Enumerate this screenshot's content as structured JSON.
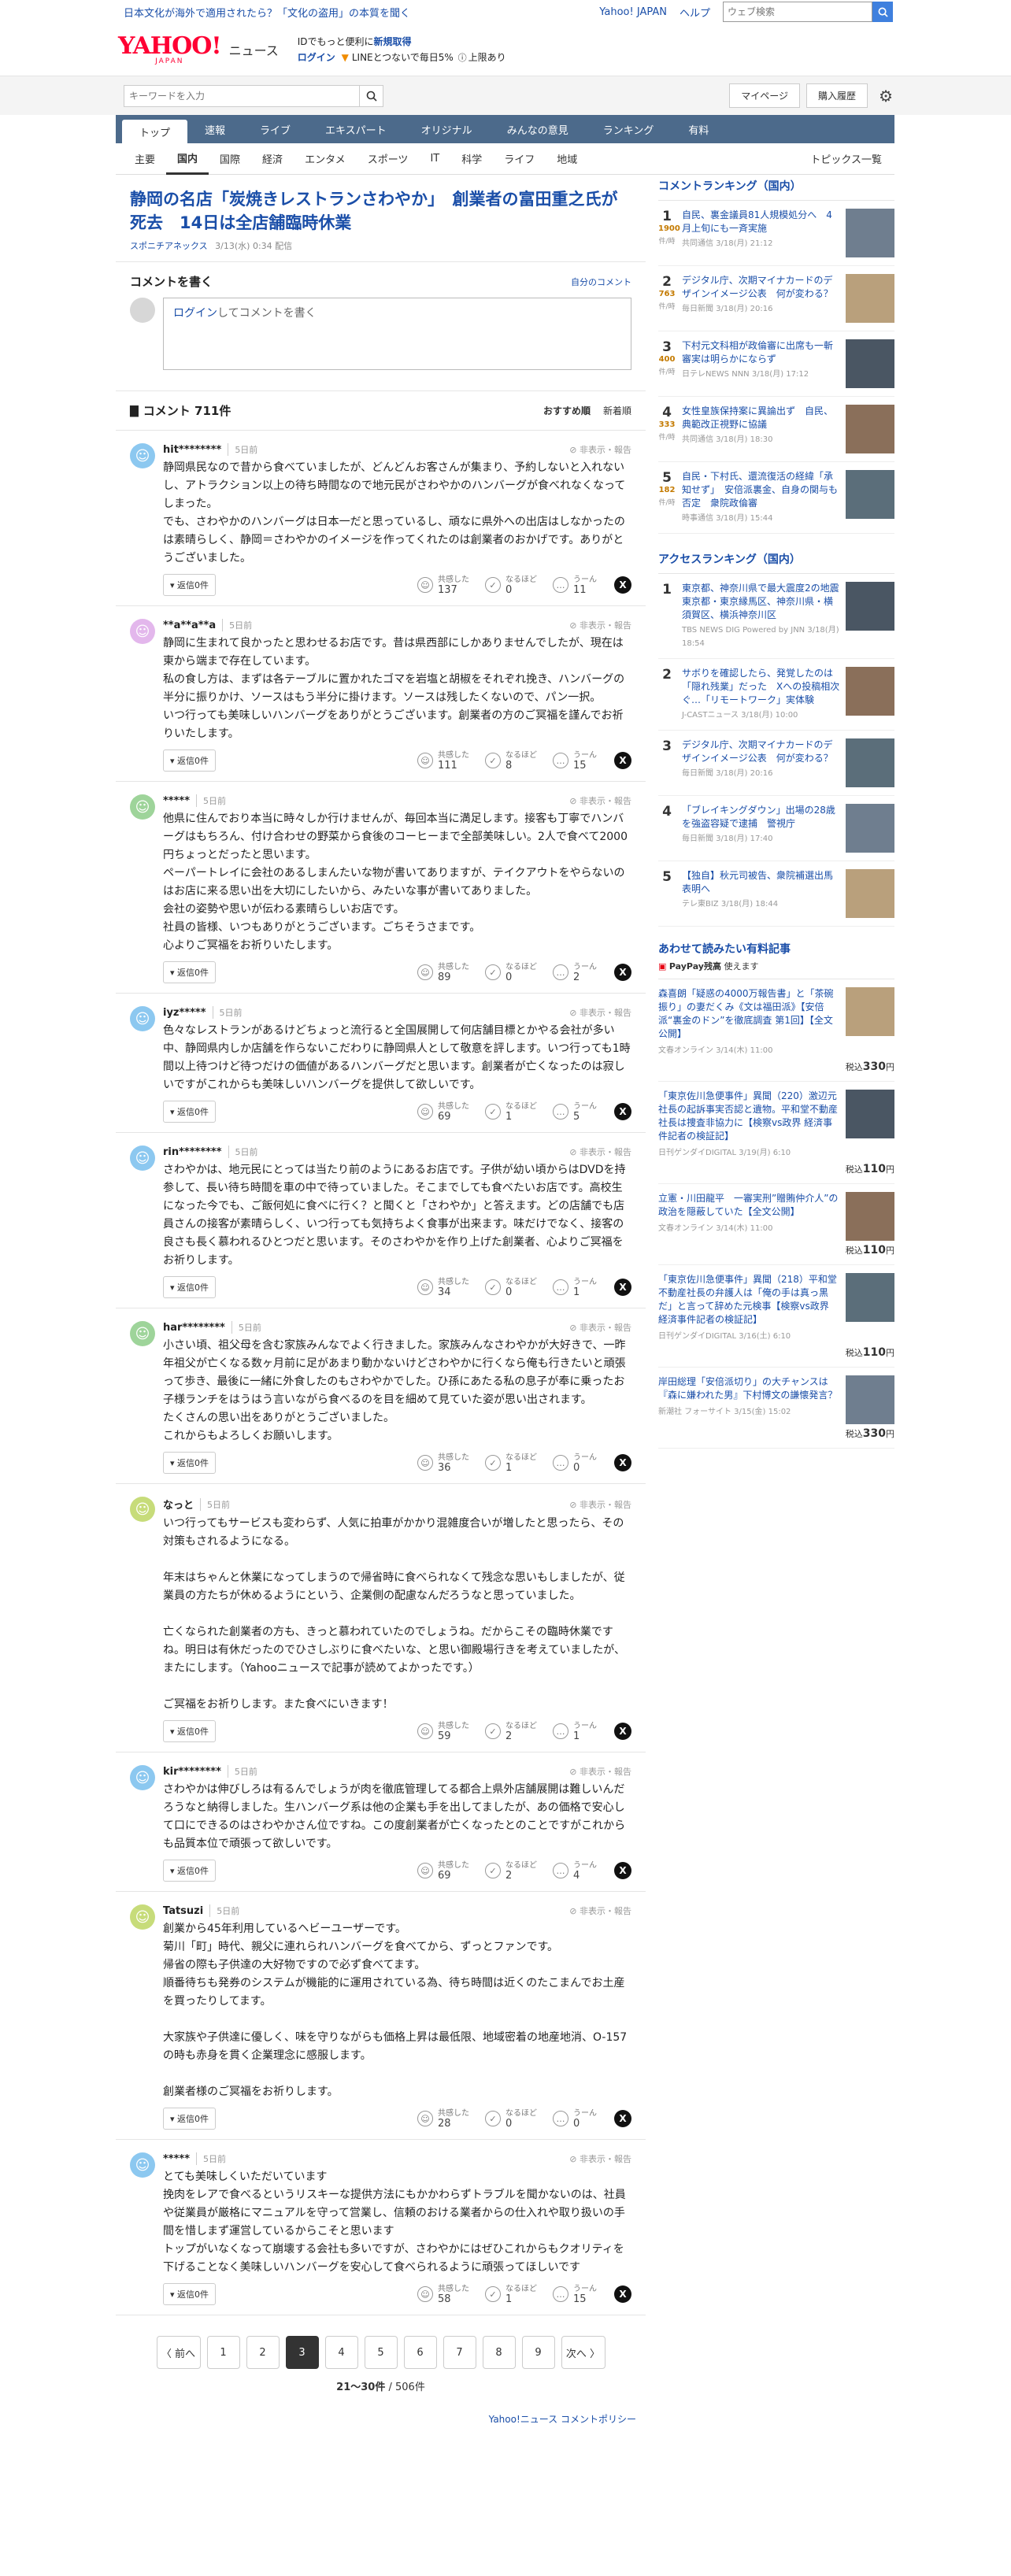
{
  "top": {
    "promo": "日本文化が海外で適用されたら？「文化の盗用」の本質を聞く",
    "yahoo_japan": "Yahoo! JAPAN",
    "help": "ヘルプ",
    "search_placeholder": "ウェブ検索"
  },
  "logo": {
    "brand": "YAHOO!",
    "jp": "JAPAN",
    "news": "ニュース"
  },
  "promo_box": {
    "l1a": "IDでもっと便利に",
    "l1b": "新規取得",
    "l2a": "ログイン",
    "l2b": "LINEとつないで毎日5%",
    "l2c": "上限あり"
  },
  "searchrow": {
    "placeholder": "キーワードを入力",
    "mypage": "マイページ",
    "history": "購入履歴"
  },
  "nav": [
    "トップ",
    "速報",
    "ライブ",
    "エキスパート",
    "オリジナル",
    "みんなの意見",
    "ランキング",
    "有料"
  ],
  "subnav": [
    "主要",
    "国内",
    "国際",
    "経済",
    "エンタメ",
    "スポーツ",
    "IT",
    "科学",
    "ライフ",
    "地域"
  ],
  "subnav_topics": "トピックス一覧",
  "article": {
    "title": "静岡の名店「炭焼きレストランさわやか」　創業者の富田重之氏が死去　14日は全店舗臨時休業",
    "source": "スポニチアネックス",
    "date": "3/13(水) 0:34 配信"
  },
  "comment_write": {
    "title": "コメントを書く",
    "own": "自分のコメント",
    "login": "ログイン",
    "rest": "してコメントを書く"
  },
  "comment_list": {
    "title": "コメント 711件",
    "sort1": "おすすめ順",
    "sort2": "新着順"
  },
  "labels": {
    "report": "非表示・報告",
    "reply": "返信0件",
    "r1": "共感した",
    "r2": "なるほど",
    "r3": "うーん"
  },
  "comments": [
    {
      "user": "hit********",
      "time": "5日前",
      "text": "静岡県民なので昔から食べていましたが、どんどんお客さんが集まり、予約しないと入れないし、アトラクション以上の待ち時間なので地元民がさわやかのハンバーグが食べれなくなってしまった。\nでも、さわやかのハンバーグは日本一だと思っているし、頑なに県外への出店はしなかったのは素晴らしく、静岡＝さわやかのイメージを作ってくれたのは創業者のおかげです。ありがとうございました。",
      "r1": "137",
      "r2": "0",
      "r3": "11",
      "color": "#8cc8f0",
      "face": "☺"
    },
    {
      "user": "**a**a**a",
      "time": "5日前",
      "text": "静岡に生まれて良かったと思わせるお店です。昔は県西部にしかありませんでしたが、現在は東から端まで存在しています。\n私の食し方は、まずは各テーブルに置かれたゴマを岩塩と胡椒をそれぞれ挽き、ハンバーグの半分に振りかけ、ソースはもう半分に掛けます。ソースは残したくないので、パン一択。\nいつ行っても美味しいハンバーグをありがとうございます。創業者の方のご冥福を謹んでお祈りいたします。",
      "r1": "111",
      "r2": "8",
      "r3": "15",
      "color": "#e3b7ec",
      "face": "☺"
    },
    {
      "user": "*****",
      "time": "5日前",
      "text": "他県に住んでおり本当に時々しか行けませんが、毎回本当に満足します。接客も丁寧でハンバーグはもちろん、付け合わせの野菜から食後のコーヒーまで全部美味しい。2人で食べて2000円ちょっとだったと思います。\nペーパートレイに会社のあるしまんたいな物が書いてありますが、テイクアウトをやらないのはお店に来る思い出を大切にしたいから、みたいな事が書いてありました。\n会社の姿勢や思いが伝わる素晴らしいお店です。\n社員の皆様、いつもありがとうございます。ごちそうさまです。\n心よりご冥福をお祈りいたします。",
      "r1": "89",
      "r2": "0",
      "r3": "2",
      "color": "#9ed49a",
      "face": "☺"
    },
    {
      "user": "iyz*****",
      "time": "5日前",
      "text": "色々なレストランがあるけどちょっと流行ると全国展開して何店舗目標とかやる会社が多い中、静岡県内しか店舗を作らないこだわりに静岡県人として敬意を評します。いつ行っても1時間以上待つけど待つだけの価値があるハンバーグだと思います。創業者が亡くなったのは寂しいですがこれからも美味しいハンバーグを提供して欲しいです。",
      "r1": "69",
      "r2": "1",
      "r3": "5",
      "color": "#8cc8f0",
      "face": "☺"
    },
    {
      "user": "rin********",
      "time": "5日前",
      "text": "さわやかは、地元民にとっては当たり前のようにあるお店です。子供が幼い頃からはDVDを持参して、長い待ち時間を車の中で待っていました。そこまでしても食べたいお店です。高校生になった今でも、ご飯何処に食べに行く？と聞くと「さわやか」と答えます。どの店舗でも店員さんの接客が素晴らしく、いつ行っても気持ちよく食事が出来ます。味だけでなく、接客の良さも長く慕われるひとつだと思います。そのさわやかを作り上げた創業者、心よりご冥福をお祈りします。",
      "r1": "34",
      "r2": "0",
      "r3": "1",
      "color": "#8cc8f0",
      "face": "☺"
    },
    {
      "user": "har********",
      "time": "5日前",
      "text": "小さい頃、祖父母を含む家族みんなでよく行きました。家族みんなさわやかが大好きで、一昨年祖父が亡くなる数ヶ月前に足があまり動かないけどさわやかに行くなら俺も行きたいと頑張って歩き、最後に一緒に外食したのもさわやかでした。ひ孫にあたる私の息子が奉に乗ったお子様ランチをはうはう言いながら食べるのを目を細めて見ていた姿が思い出されます。\nたくさんの思い出をありがとうございました。\nこれからもよろしくお願いします。",
      "r1": "36",
      "r2": "1",
      "r3": "0",
      "color": "#9ed49a",
      "face": "☺"
    },
    {
      "user": "なっと",
      "time": "5日前",
      "text": "いつ行ってもサービスも変わらず、人気に拍車がかかり混雑度合いが増したと思ったら、その対策もされるようになる。\n\n年末はちゃんと休業になってしまうので帰省時に食べられなくて残念な思いもしましたが、従業員の方たちが休めるようにという、企業側の配慮なんだろうなと思っていました。\n\n亡くなられた創業者の方も、きっと慕われていたのでしょうね。だからこその臨時休業ですね。明日は有休だったのでひさしぶりに食べたいな、と思い御殿場行きを考えていましたが、またにします。（Yahooニュースで記事が読めてよかったです。）\n\nご冥福をお祈りします。また食べにいきます！",
      "r1": "59",
      "r2": "2",
      "r3": "1",
      "color": "#c7dc7a",
      "face": "☺"
    },
    {
      "user": "kir********",
      "time": "5日前",
      "text": "さわやかは伸びしろは有るんでしょうが肉を徹底管理してる都合上県外店舗展開は難しいんだろうなと納得しました。生ハンバーグ系は他の企業も手を出してましたが、あの価格で安心して口にできるのはさわやかさん位ですね。この度創業者が亡くなったとのことですがこれからも品質本位で頑張って欲しいです。",
      "r1": "69",
      "r2": "2",
      "r3": "4",
      "color": "#8cc8f0",
      "face": "☺"
    },
    {
      "user": "Tatsuzi",
      "time": "5日前",
      "text": "創業から45年利用しているヘビーユーザーです。\n菊川「町」時代、親父に連れられハンバーグを食べてから、ずっとファンです。\n帰省の際も子供達の大好物ですので必ず食べてます。\n順番待ちも発券のシステムが機能的に運用されている為、待ち時間は近くのたこまんでお土産を買ったりしてます。\n\n大家族や子供達に優しく、味を守りながらも価格上昇は最低限、地域密着の地産地消、O-157の時も赤身を貫く企業理念に感服します。\n\n創業者様のご冥福をお祈りします。",
      "r1": "28",
      "r2": "0",
      "r3": "0",
      "color": "#c7dc7a",
      "face": "☺"
    },
    {
      "user": "*****",
      "time": "5日前",
      "text": "とても美味しくいただいています\n挽肉をレアで食べるというリスキーな提供方法にもかかわらずトラブルを聞かないのは、社員や従業員が厳格にマニュアルを守って営業し、信頼のおける業者からの仕入れや取り扱いの手間を惜しまず運営しているからこそと思います\nトップがいなくなって崩壊する会社も多いですが、さわやかにはぜひこれからもクオリティを下げることなく美味しいハンバーグを安心して食べられるように頑張ってほしいです",
      "r1": "58",
      "r2": "1",
      "r3": "15",
      "color": "#8cc8f0",
      "face": "☺"
    }
  ],
  "pager": {
    "prev": "〈 前へ",
    "next": "次へ 〉",
    "pages": [
      "1",
      "2",
      "3",
      "4",
      "5",
      "6",
      "7",
      "8",
      "9"
    ],
    "current": "3",
    "count": "21〜30件",
    "total": " / 506件"
  },
  "policy": "Yahoo!ニュース コメントポリシー",
  "comment_ranking": {
    "title": "コメントランキング（国内）",
    "items": [
      {
        "rank": "1",
        "count": "1900",
        "unit": "件/時",
        "title": "自民、裏金議員81人規模処分へ　4月上旬にも一斉実施",
        "src": "共同通信 3/18(月) 21:12"
      },
      {
        "rank": "2",
        "count": "763",
        "unit": "件/時",
        "title": "デジタル庁、次期マイナカードのデザインイメージ公表　何が変わる？",
        "src": "毎日新聞 3/18(月) 20:16"
      },
      {
        "rank": "3",
        "count": "400",
        "unit": "件/時",
        "title": "下村元文科相が政倫審に出席も一斬審実は明らかにならず",
        "src": "日テレNEWS NNN 3/18(月) 17:12"
      },
      {
        "rank": "4",
        "count": "333",
        "unit": "件/時",
        "title": "女性皇族保持案に異論出ず　自民、典範改正視野に協議",
        "src": "共同通信 3/18(月) 18:30"
      },
      {
        "rank": "5",
        "count": "182",
        "unit": "件/時",
        "title": "自民・下村氏、還流復活の経緯「承知せず」　安倍派裏金、自身の関与も否定　衆院政倫審",
        "src": "時事通信 3/18(月) 15:44"
      }
    ]
  },
  "access_ranking": {
    "title": "アクセスランキング（国内）",
    "items": [
      {
        "rank": "1",
        "title": "東京都、神奈川県で最大震度2の地震　東京都・東京縁馬区、神奈川県・横須賀区、横浜神奈川区",
        "src": "TBS NEWS DIG Powered by JNN 3/18(月) 18:54"
      },
      {
        "rank": "2",
        "title": "サボりを確認したら、発覚したのは「隠れ残業」だった　Xへの投稿相次ぐ…「リモートワーク」実体験",
        "src": "J-CASTニュース 3/18(月) 10:00"
      },
      {
        "rank": "3",
        "title": "デジタル庁、次期マイナカードのデザインイメージ公表　何が変わる？",
        "src": "毎日新聞 3/18(月) 20:16"
      },
      {
        "rank": "4",
        "title": "「ブレイキングダウン」出場の28歳を強盗容疑で逮捕　警視庁",
        "src": "毎日新聞 3/18(月) 17:40"
      },
      {
        "rank": "5",
        "title": "【独自】秋元司被告、衆院補選出馬表明へ",
        "src": "テレ東BIZ 3/18(月) 18:44"
      }
    ]
  },
  "paid": {
    "title": "あわせて読みたい有料記事",
    "paypay_label": "PayPay残高",
    "paypay_rest": "使えます",
    "items": [
      {
        "title": "森喜朗「疑惑の4000万報告書」と「茶碗振り」の妻だくみ《文は福田派》【安倍派“裏金のドン”を徹底調査 第1回】【全文公開】",
        "src": "文春オンライン 3/14(木) 11:00",
        "price_prefix": "税込",
        "price": "330",
        "unit": "円"
      },
      {
        "title": "「東京佐川急便事件」異聞（220）激辺元社長の起訴事実否認と遺物。平和堂不動産社長は捜査非協力に【検察vs政界 経済事件記者の検証記】",
        "src": "日刊ゲンダイDIGITAL 3/19(月) 6:10",
        "price_prefix": "税込",
        "price": "110",
        "unit": "円"
      },
      {
        "title": "立憲・川田龍平　一審実刑”贈賄仲介人”の政治を隠蔽していた【全文公開】",
        "src": "文春オンライン 3/14(木) 11:00",
        "price_prefix": "税込",
        "price": "110",
        "unit": "円"
      },
      {
        "title": "「東京佐川急便事件」異聞（218）平和堂不動産社長の弁護人は「俺の手は真っ黒だ」と言って辞めた元検事【検察vs政界 経済事件記者の検証記】",
        "src": "日刊ゲンダイDIGITAL 3/16(土) 6:10",
        "price_prefix": "税込",
        "price": "110",
        "unit": "円"
      },
      {
        "title": "岸田総理「安倍派切り」の大チャンスは『森に嫌われた男』下村博文の謙懐発言？",
        "src": "新潮社 フォーサイト 3/15(金) 15:02",
        "price_prefix": "税込",
        "price": "330",
        "unit": "円"
      }
    ]
  }
}
